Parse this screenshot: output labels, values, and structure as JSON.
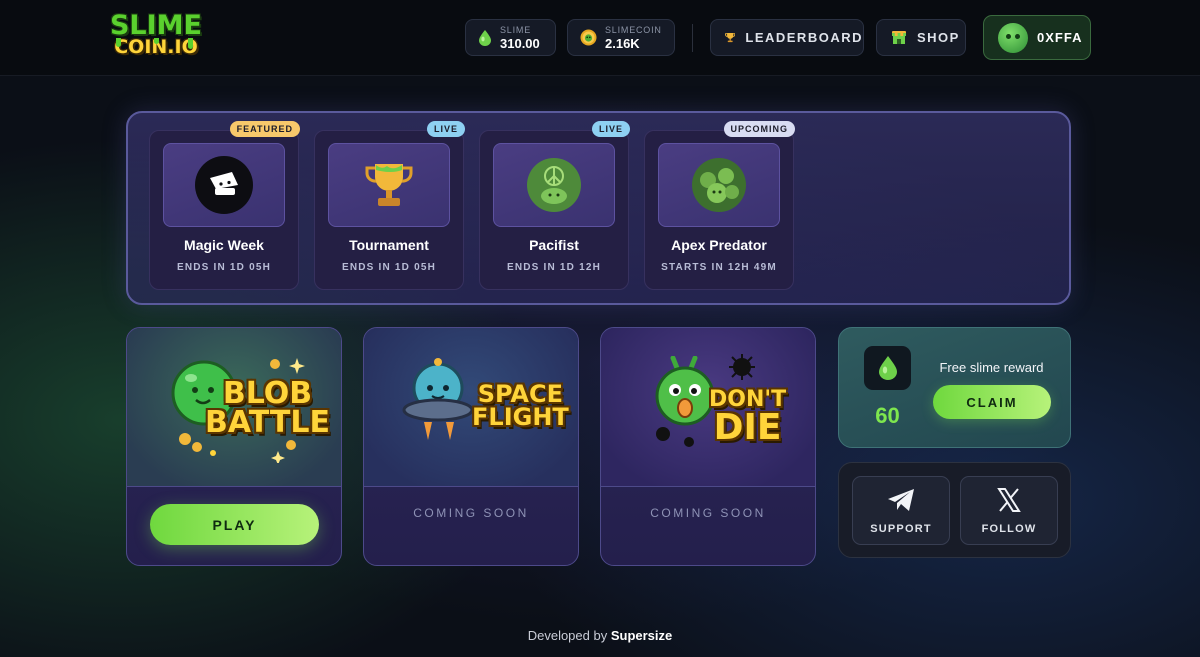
{
  "header": {
    "logo": {
      "line1": "SLIME",
      "line2": "COIN.IO"
    },
    "balances": [
      {
        "label": "SLIME",
        "value": "310.00",
        "icon": "slime-drop-icon"
      },
      {
        "label": "SLIMECOIN",
        "value": "2.16K",
        "icon": "slimecoin-icon"
      }
    ],
    "leaderboard_label": "LEADERBOARD",
    "shop_label": "SHOP",
    "wallet_label": "0XFFA"
  },
  "events": [
    {
      "title": "Magic Week",
      "status": "ENDS IN 1D 05H",
      "badge": "FEATURED",
      "icon": "magic-hat-icon"
    },
    {
      "title": "Tournament",
      "status": "ENDS IN 1D 05H",
      "badge": "LIVE",
      "icon": "trophy-icon"
    },
    {
      "title": "Pacifist",
      "status": "ENDS IN 1D 12H",
      "badge": "LIVE",
      "icon": "peace-slime-icon"
    },
    {
      "title": "Apex Predator",
      "status": "STARTS IN 12H 49M",
      "badge": "UPCOMING",
      "icon": "slime-horde-icon"
    }
  ],
  "games": [
    {
      "title_line1": "BLOB",
      "title_line2": "BATTLE",
      "action": "PLAY"
    },
    {
      "title_line1": "SPACE",
      "title_line2": "FLIGHT",
      "status": "COMING SOON"
    },
    {
      "title_line1": "DON'T",
      "title_line2": "DIE",
      "status": "COMING SOON"
    }
  ],
  "reward": {
    "label": "Free slime reward",
    "amount": "60",
    "button": "CLAIM"
  },
  "social": {
    "support_label": "SUPPORT",
    "follow_label": "FOLLOW"
  },
  "footer": {
    "prefix": "Developed by",
    "brand": "Supersize"
  },
  "colors": {
    "accent_green": "#7ee64e",
    "coin_yellow": "#ffd43a",
    "panel_purple": "#2a2757"
  }
}
